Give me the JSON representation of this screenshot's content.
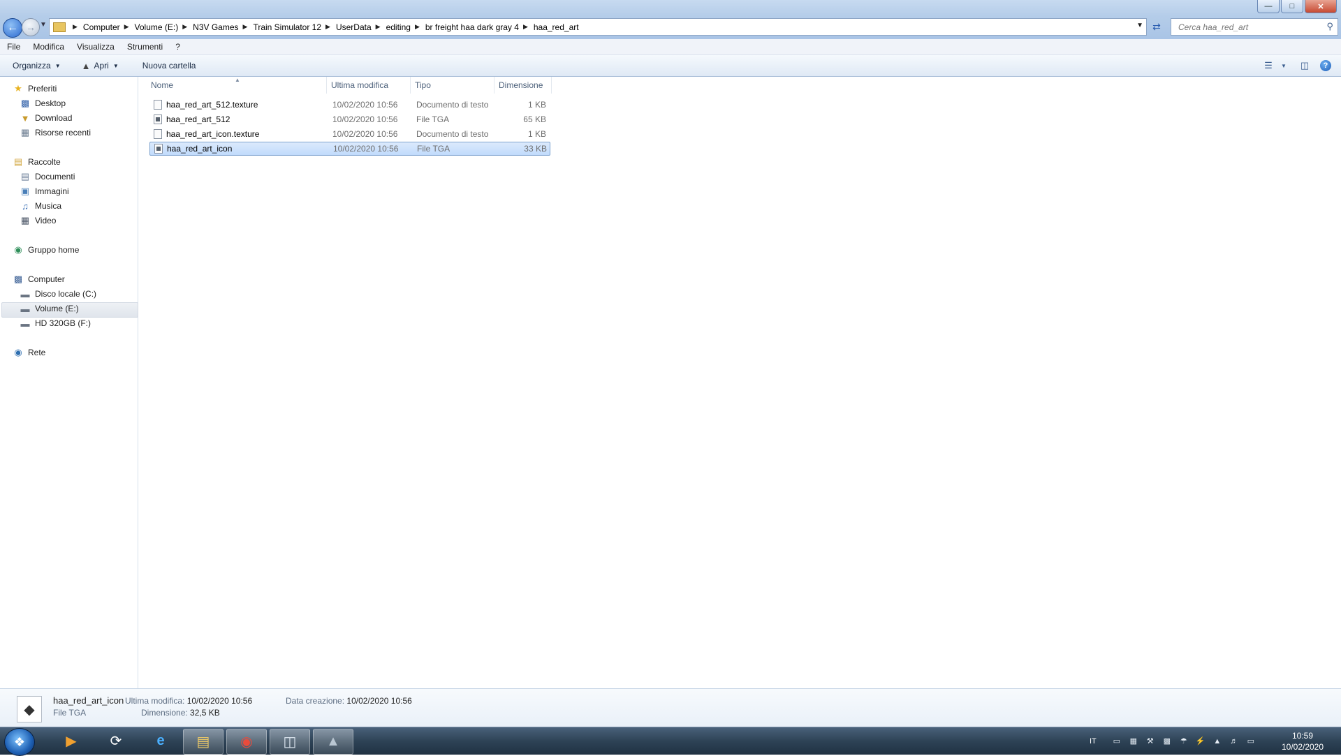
{
  "window": {
    "controls": {
      "minimize": "—",
      "maximize": "□",
      "close": "✕"
    }
  },
  "address": {
    "crumbs": [
      "Computer",
      "Volume (E:)",
      "N3V Games",
      "Train Simulator 12",
      "UserData",
      "editing",
      "br freight haa dark gray 4",
      "haa_red_art"
    ]
  },
  "search": {
    "placeholder": "Cerca haa_red_art"
  },
  "menu": [
    "File",
    "Modifica",
    "Visualizza",
    "Strumenti",
    "?"
  ],
  "commands": {
    "organize": "Organizza",
    "open": "Apri",
    "new_folder": "Nuova cartella"
  },
  "nav": {
    "favorites": {
      "label": "Preferiti",
      "items": [
        "Desktop",
        "Download",
        "Risorse recenti"
      ]
    },
    "libraries": {
      "label": "Raccolte",
      "items": [
        "Documenti",
        "Immagini",
        "Musica",
        "Video"
      ]
    },
    "homegroup": {
      "label": "Gruppo home"
    },
    "computer": {
      "label": "Computer",
      "items": [
        "Disco locale (C:)",
        "Volume (E:)",
        "HD 320GB (F:)"
      ]
    },
    "network": {
      "label": "Rete"
    }
  },
  "columns": {
    "name": "Nome",
    "modified": "Ultima modifica",
    "type": "Tipo",
    "size": "Dimensione"
  },
  "files": [
    {
      "name": "haa_red_art_512.texture",
      "modified": "10/02/2020 10:56",
      "type": "Documento di testo",
      "size": "1 KB"
    },
    {
      "name": "haa_red_art_512",
      "modified": "10/02/2020 10:56",
      "type": "File TGA",
      "size": "65 KB"
    },
    {
      "name": "haa_red_art_icon.texture",
      "modified": "10/02/2020 10:56",
      "type": "Documento di testo",
      "size": "1 KB"
    },
    {
      "name": "haa_red_art_icon",
      "modified": "10/02/2020 10:56",
      "type": "File TGA",
      "size": "33 KB"
    }
  ],
  "details": {
    "name": "haa_red_art_icon",
    "type": "File TGA",
    "modified_label": "Ultima modifica:",
    "modified_value": "10/02/2020 10:56",
    "size_label": "Dimensione:",
    "size_value": "32,5 KB",
    "created_label": "Data creazione:",
    "created_value": "10/02/2020 10:56"
  },
  "taskbar": {
    "language": "IT",
    "time": "10:59",
    "date": "10/02/2020"
  }
}
